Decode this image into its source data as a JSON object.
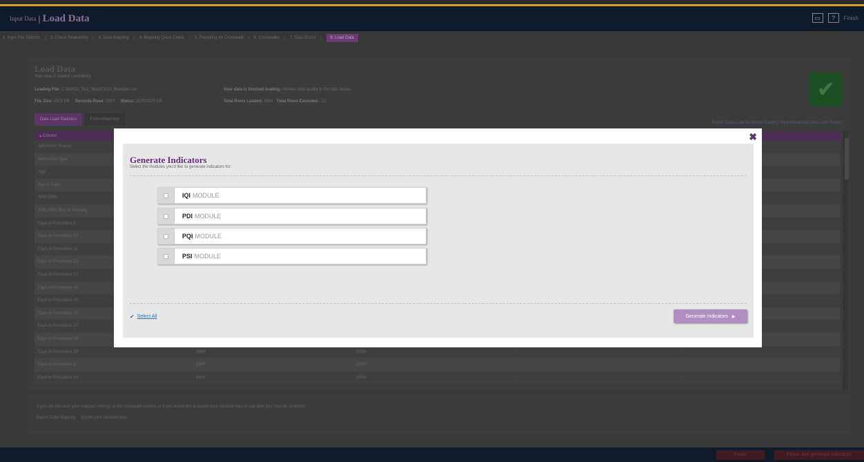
{
  "header": {
    "section": "Input Data",
    "title": "Load Data",
    "finish_label": "Finish"
  },
  "steps": [
    "1. Input File Options",
    "2. Check Readability",
    "3. Data Mapping",
    "4. Mapping Quick Check",
    "5. Preparing for Crosswalk",
    "6. Crosswalks",
    "7. Data Errors",
    "8. Load Data"
  ],
  "summary": {
    "title": "Load Data",
    "subtitle": "Your data is loaded completely",
    "loading_file_label": "Loading File:",
    "loading_file": "C:\\WINDI_Test_files\\ICD10_9sample.csv",
    "file_size_label": "File Size:",
    "file_size": "2570 KB",
    "records_read_label": "Records Read:",
    "records_read": "9907",
    "status_label": "Status:",
    "status": "2570/2570 KB",
    "finished_bold": "Your data is finished loading.",
    "finished_rest": "Review data quality in the tabs below.",
    "total_loaded_label": "Total Rows Loaded:",
    "total_loaded": "9894",
    "total_excluded_label": "Total Rows Excluded :",
    "total_excluded": "12"
  },
  "tabs": [
    "Data Load Statistics",
    "Errors/Warnings"
  ],
  "table_links": {
    "export": "Export Data Load Summary Report",
    "advanced": "View Advanced Data Load Report"
  },
  "table": {
    "header": "Column",
    "rows": [
      [
        "Admission Source",
        "",
        "",
        "",
        ""
      ],
      [
        "Admission Type",
        "",
        "",
        "",
        ""
      ],
      [
        "Age",
        "",
        "",
        "",
        ""
      ],
      [
        "Age in Days",
        "",
        "",
        "",
        ""
      ],
      [
        "APR-DRG",
        "",
        "",
        "",
        ""
      ],
      [
        "APR-DRG Risk of Mortality",
        "",
        "",
        "",
        ""
      ],
      [
        "Days to Procedure 1",
        "",
        "",
        "",
        ""
      ],
      [
        "Days to Procedure 10",
        "",
        "",
        "",
        ""
      ],
      [
        "Days to Procedure 11",
        "",
        "",
        "",
        ""
      ],
      [
        "Days to Procedure 12",
        "",
        "",
        "",
        ""
      ],
      [
        "Days to Procedure 13",
        "",
        "",
        "",
        ""
      ],
      [
        "Days to Procedure 14",
        "",
        "",
        "",
        ""
      ],
      [
        "Days to Procedure 15",
        "",
        "",
        "",
        ""
      ],
      [
        "Days to Procedure 16",
        "",
        "",
        "",
        ""
      ],
      [
        "Days to Procedure 17",
        "",
        "",
        "",
        ""
      ],
      [
        "Days to Procedure 18",
        "",
        "",
        "",
        ""
      ],
      [
        "Days to Procedure 19",
        "9894",
        "100%",
        "-",
        "-"
      ],
      [
        "Days to Procedure 2",
        "9894",
        "100%",
        "-",
        "-"
      ],
      [
        "Days to Procedure 20",
        "9894",
        "100%",
        "-",
        "-"
      ]
    ]
  },
  "export_panel": {
    "message": "If you did not save your mapped settings at the crosswalk screen, or if you would like to export your cleaned data to use later you may do so below.",
    "export_mapping": "Export Data Mapping",
    "export_cleaned": "Export your cleaned data"
  },
  "footer": {
    "finish": "Finish",
    "finish_generate": "Finish and generate indicators"
  },
  "modal": {
    "title": "Generate Indicators",
    "subtitle": "Select the modules you'd like to generate indicators for:",
    "modules": [
      {
        "name": "IQI",
        "suffix": "MODULE"
      },
      {
        "name": "PDI",
        "suffix": "MODULE"
      },
      {
        "name": "PQI",
        "suffix": "MODULE"
      },
      {
        "name": "PSI",
        "suffix": "MODULE"
      }
    ],
    "select_all": "Select All",
    "generate_button": "Generate Indicators",
    "close_glyph": "✖"
  },
  "colors": {
    "accent_purple": "#6b2d7d",
    "button_purple": "#b08ec4",
    "link_blue": "#2a6fb0",
    "success_green": "#1c4f22"
  }
}
